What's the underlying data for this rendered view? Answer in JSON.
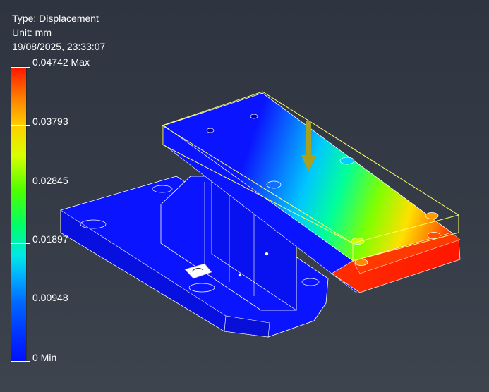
{
  "result_info": {
    "type_text": "Type: Displacement",
    "unit_text": "Unit: mm",
    "timestamp": "19/08/2025, 23:33:07"
  },
  "legend": {
    "ticks": [
      {
        "label": "0.04742 Max",
        "value": 0.04742
      },
      {
        "label": "0.03793",
        "value": 0.03793
      },
      {
        "label": "0.02845",
        "value": 0.02845
      },
      {
        "label": "0.01897",
        "value": 0.01897
      },
      {
        "label": "0.00948",
        "value": 0.00948
      },
      {
        "label": "0 Min",
        "value": 0
      }
    ],
    "colors": [
      "#ff1500",
      "#ff7a00",
      "#ffd000",
      "#4cff00",
      "#00e8e8",
      "#0036ff",
      "#0010ff"
    ]
  },
  "model": {
    "base_color": "#0a14ff",
    "load_arrow_color": "#a8a020",
    "undeformed_outline_color": "#ffff66",
    "icons": [
      "load-arrow-icon",
      "constraint-icon"
    ]
  }
}
